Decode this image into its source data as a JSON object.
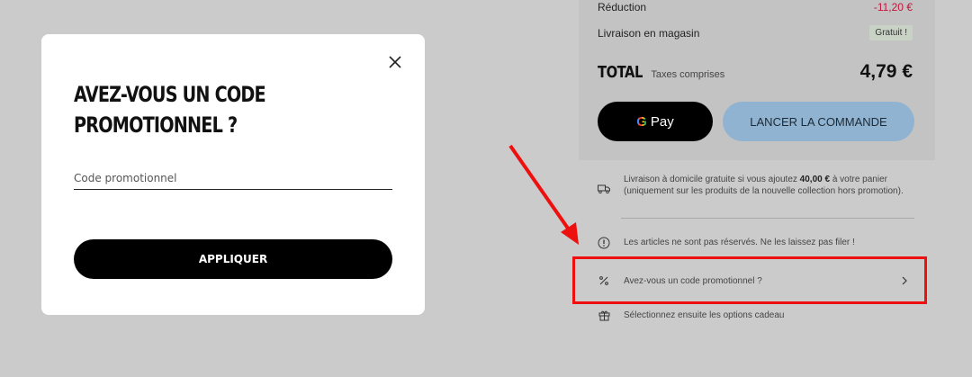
{
  "summary": {
    "reduction_label": "Réduction",
    "reduction_value": "-11,20 €",
    "delivery_label": "Livraison en magasin",
    "delivery_value": "Gratuit !",
    "total_label": "TOTAL",
    "total_sub": "Taxes comprises",
    "total_amount": "4,79 €",
    "gpay_g": "G",
    "gpay_label": "Pay",
    "order_button": "LANCER LA COMMANDE"
  },
  "info": {
    "shipping_text_before": "Livraison à domicile gratuite si vous ajoutez",
    "shipping_amount": "40,00 €",
    "shipping_text_after": "à votre panier (uniquement sur les produits de la nouvelle collection hors promotion).",
    "reserved_text": "Les articles ne sont pas réservés. Ne les laissez pas filer !",
    "promo_link": "Avez-vous un code promotionnel ?",
    "gift_text": "Sélectionnez ensuite les options cadeau"
  },
  "modal": {
    "title": "AVEZ-VOUS UN CODE PROMOTIONNEL ?",
    "input_placeholder": "Code promotionnel",
    "apply_button": "APPLIQUER"
  },
  "icons": {
    "close": "close-icon",
    "truck": "truck-icon",
    "alert": "alert-circle-icon",
    "percent": "percent-icon",
    "chevron": "chevron-right-icon",
    "gift": "gift-icon"
  },
  "colors": {
    "accent_red": "#ee0f0f",
    "reduction_red": "#c4143c",
    "order_button": "#8fb3d1"
  }
}
